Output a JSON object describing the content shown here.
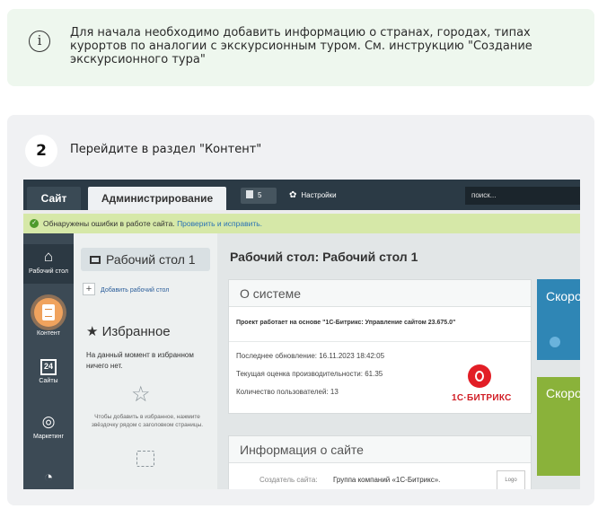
{
  "info": {
    "icon": "info-icon",
    "text": "Для начала необходимо добавить информацию о странах, городах, типах курортов по аналогии с экскурсионным туром. См. инструкцию \"Создание экскурсионного тура\""
  },
  "step": {
    "number": "2",
    "text": "Перейдите в раздел \"Контент\""
  },
  "screenshot": {
    "tabs": {
      "site": "Сайт",
      "admin": "Администрирование"
    },
    "notifications_count": "5",
    "settings_label": "Настройки",
    "search_placeholder": "поиск...",
    "alert": {
      "text": "Обнаружены ошибки в работе сайта.",
      "link": "Проверить и исправить."
    },
    "left_nav": [
      {
        "label": "Рабочий стол",
        "icon": "home-icon"
      },
      {
        "label": "Контент",
        "icon": "document-icon"
      },
      {
        "label": "Сайты",
        "icon": "calendar-icon",
        "icon_text": "24"
      },
      {
        "label": "Маркетинг",
        "icon": "target-icon"
      }
    ],
    "panel": {
      "desktop_button": "Рабочий стол 1",
      "add_desktop": "Добавить рабочий стол",
      "favorites_title": "Избранное",
      "favorites_empty": "На данный момент в избранном ничего нет.",
      "favorites_hint": "Чтобы добавить в избранное, нажмите звёздочку рядом с заголовком страницы."
    },
    "main": {
      "title": "Рабочий стол: Рабочий стол 1",
      "system_card": {
        "header": "О системе",
        "project": "Проект работает на основе \"1С-Битрикс: Управление сайтом 23.675.0\"",
        "last_update": "Последнее обновление: 16.11.2023 18:42:05",
        "performance": "Текущая оценка производительности: 61.35",
        "users": "Количество пользователей: 13",
        "logo_text": "1С·БИТРИКС"
      },
      "site_card": {
        "header": "Информация о сайте",
        "creator_label": "Создатель сайта:",
        "creator_value": "Группа компаний «1С-Битрикс».",
        "logo_label": "Logo"
      },
      "side_widgets": [
        {
          "text": "Скорость"
        },
        {
          "text": "Скорость"
        }
      ]
    }
  }
}
